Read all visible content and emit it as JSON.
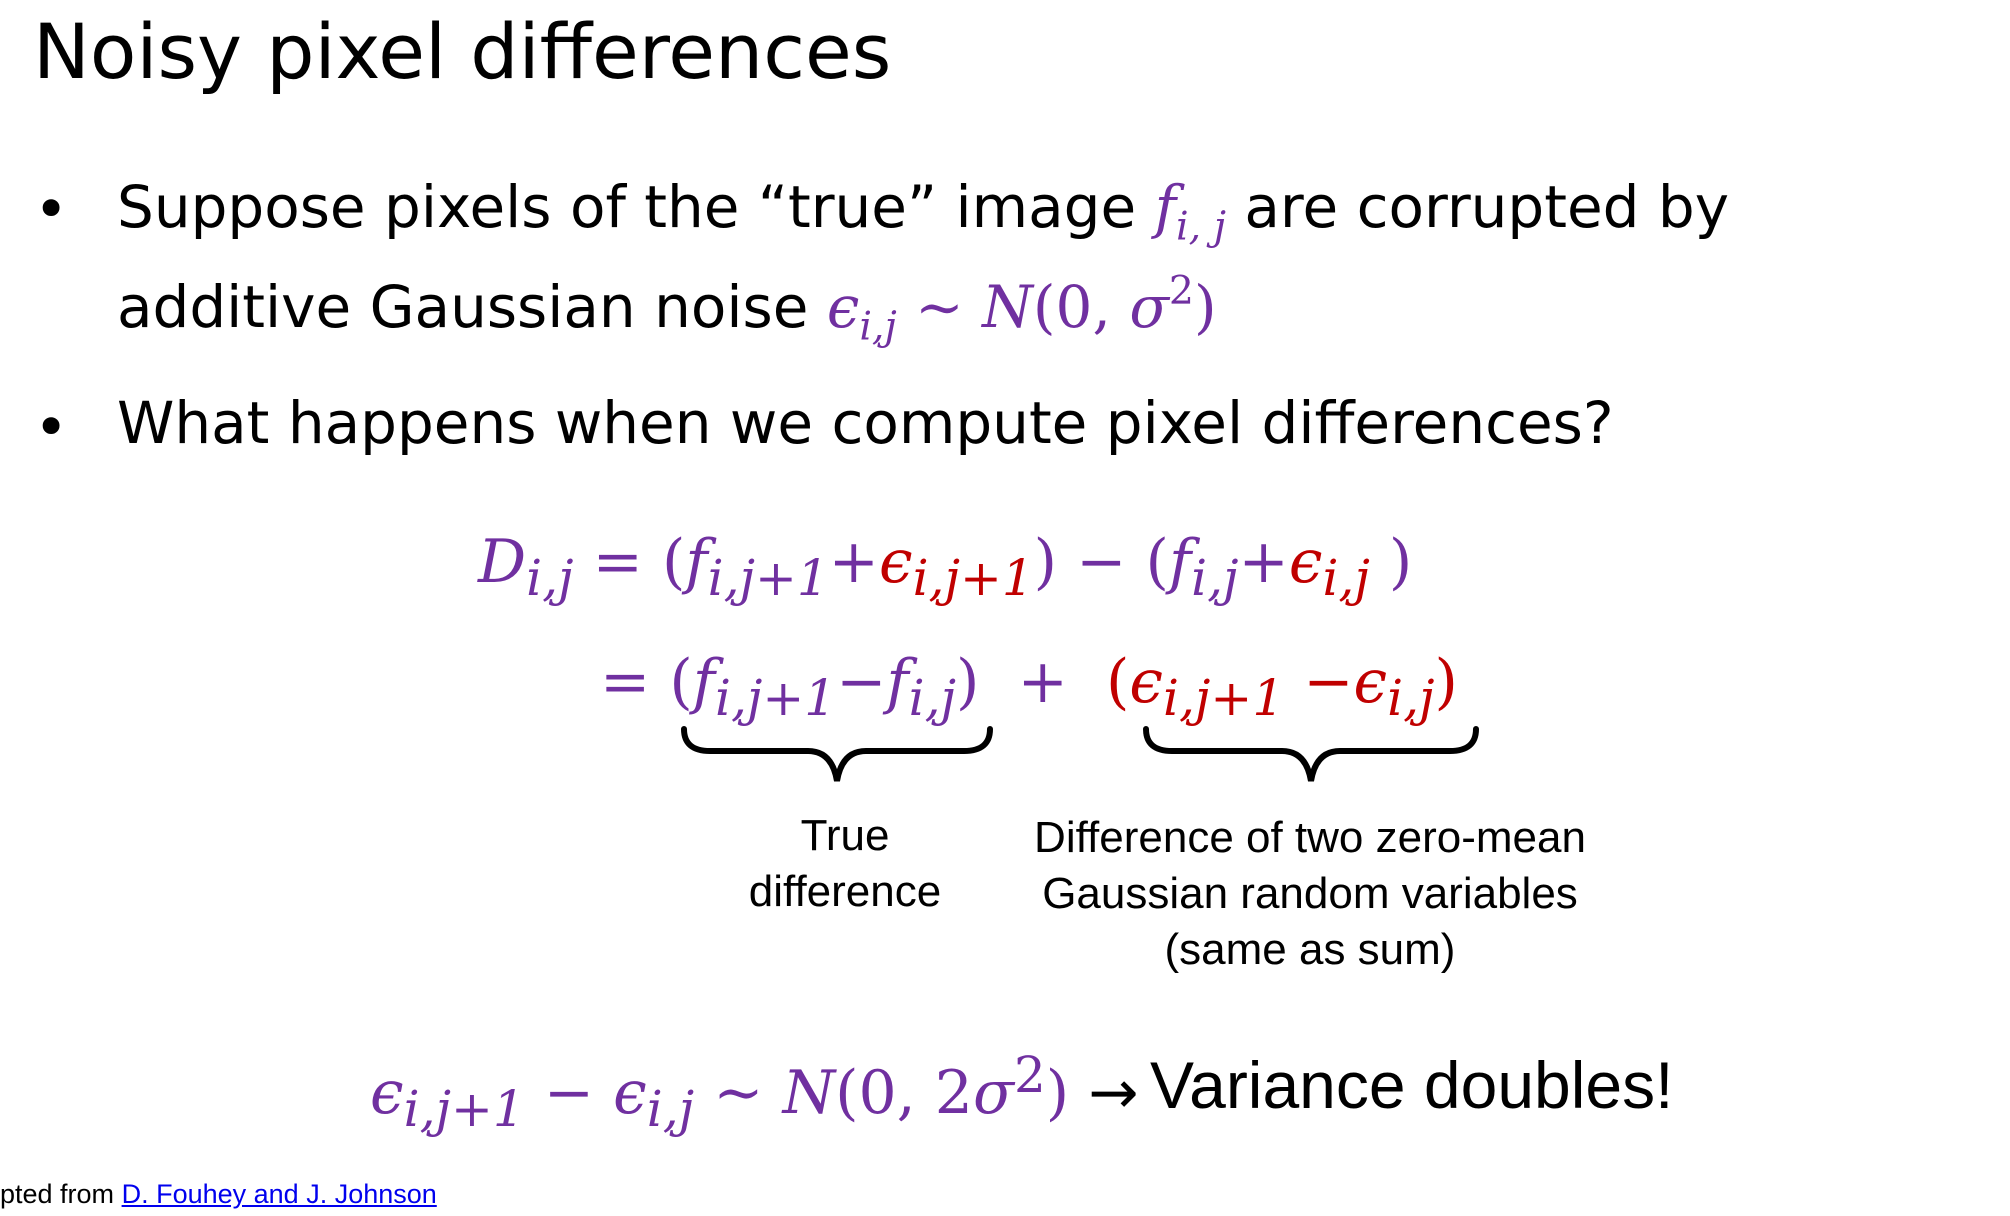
{
  "slide": {
    "title": "Noisy pixel differences",
    "bullets": [
      {
        "marker": "•",
        "line1_text": "Suppose pixels of the “true” image",
        "line1_math_base": "f",
        "line1_math_sub": "i, j",
        "line1_tail": "are corrupted by",
        "line2_text": "additive Gaussian noise",
        "line2_math": {
          "eps": "ϵ",
          "eps_sub": "i,j",
          "tilde": "∼",
          "N": "N",
          "open": "(0, ",
          "sigma": "σ",
          "sup": "2",
          "close": ")"
        }
      },
      {
        "marker": "•",
        "text": "What happens when we compute pixel differences?"
      }
    ],
    "equation": {
      "line1": {
        "D": "D",
        "D_sub": "i,j",
        "eq": "=",
        "open1": "(",
        "f": "f",
        "sub_ij1": "i,j+1",
        "plus": "+",
        "eps": "ϵ",
        "close1": ")",
        "minus": "−",
        "open2": "(",
        "sub_ij": "i,j",
        "close2": ")"
      },
      "line2": {
        "eq": "=",
        "open": "(",
        "f": "f",
        "sub_ij1": "i,j+1",
        "minus": "−",
        "sub_ij": "i,j",
        "close": ")",
        "plus": "+",
        "eps": "ϵ"
      }
    },
    "annotations": {
      "true_difference": [
        "True",
        "difference"
      ],
      "noise_difference": [
        "Difference of two zero-mean",
        "Gaussian random variables",
        "(same as sum)"
      ]
    },
    "conclusion": {
      "eps": "ϵ",
      "sub_ij1": "i,j+1",
      "minus": "−",
      "sub_ij": "i,j",
      "tilde": "∼",
      "N": "N",
      "open": "(0, 2",
      "sigma": "σ",
      "sup": "2",
      "close": ")",
      "arrow": "→",
      "text": "Variance doubles!"
    },
    "credit": {
      "prefix": "pted from",
      "link_text": "D. Fouhey and J. Johnson"
    },
    "colors": {
      "purple": "#7030a0",
      "red": "#c00000",
      "link": "#0000ee"
    }
  }
}
